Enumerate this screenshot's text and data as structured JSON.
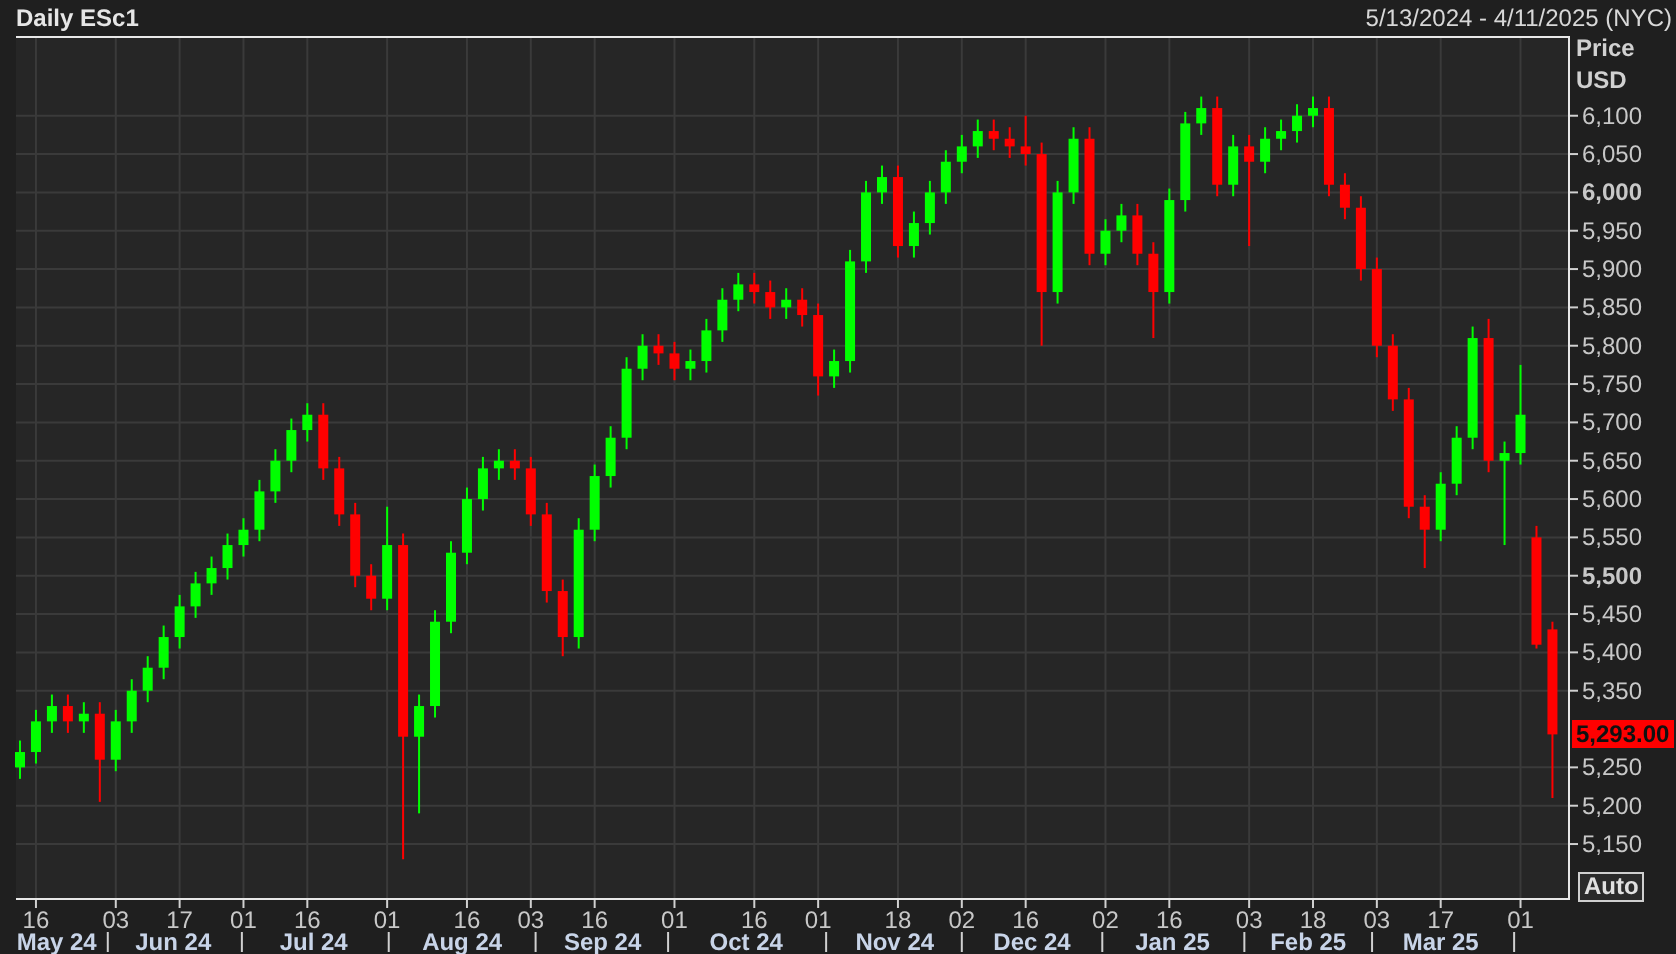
{
  "header": {
    "date_range": "5/13/2024 - 4/11/2025 (NYC)"
  },
  "chart": {
    "chart_data": {
      "type": "candlestick",
      "title": "Daily ESc1",
      "ylabel": "Price USD",
      "grid": true,
      "ylim": [
        5077,
        6204
      ],
      "categories": [
        null,
        "16",
        null,
        null,
        null,
        null,
        "03",
        null,
        null,
        null,
        "17",
        null,
        null,
        null,
        "01",
        null,
        null,
        null,
        "16",
        null,
        null,
        null,
        null,
        "01",
        null,
        null,
        null,
        null,
        "16",
        null,
        null,
        null,
        "03",
        null,
        null,
        null,
        "16",
        null,
        null,
        null,
        null,
        "01",
        null,
        null,
        null,
        null,
        "16",
        null,
        null,
        null,
        "01",
        null,
        null,
        null,
        null,
        "18",
        null,
        null,
        null,
        "02",
        null,
        null,
        null,
        "16",
        null,
        null,
        null,
        null,
        "02",
        null,
        null,
        null,
        "16",
        null,
        null,
        null,
        null,
        "03",
        null,
        null,
        null,
        "18",
        null,
        null,
        null,
        "03",
        null,
        null,
        null,
        "17",
        null,
        null,
        null,
        null,
        "01",
        null,
        null
      ],
      "ohlc": [
        [
          5250,
          5285,
          5235,
          5270
        ],
        [
          5270,
          5325,
          5255,
          5310
        ],
        [
          5310,
          5345,
          5295,
          5330
        ],
        [
          5330,
          5345,
          5295,
          5310
        ],
        [
          5310,
          5335,
          5295,
          5320
        ],
        [
          5320,
          5335,
          5205,
          5260
        ],
        [
          5260,
          5325,
          5245,
          5310
        ],
        [
          5310,
          5365,
          5295,
          5350
        ],
        [
          5350,
          5395,
          5335,
          5380
        ],
        [
          5380,
          5435,
          5365,
          5420
        ],
        [
          5420,
          5475,
          5405,
          5460
        ],
        [
          5460,
          5505,
          5445,
          5490
        ],
        [
          5490,
          5525,
          5475,
          5510
        ],
        [
          5510,
          5555,
          5495,
          5540
        ],
        [
          5540,
          5575,
          5525,
          5560
        ],
        [
          5560,
          5625,
          5545,
          5610
        ],
        [
          5610,
          5665,
          5595,
          5650
        ],
        [
          5650,
          5705,
          5635,
          5690
        ],
        [
          5690,
          5725,
          5675,
          5710
        ],
        [
          5710,
          5725,
          5625,
          5640
        ],
        [
          5640,
          5655,
          5565,
          5580
        ],
        [
          5580,
          5595,
          5485,
          5500
        ],
        [
          5500,
          5515,
          5455,
          5470
        ],
        [
          5470,
          5590,
          5455,
          5540
        ],
        [
          5540,
          5555,
          5130,
          5290
        ],
        [
          5290,
          5345,
          5190,
          5330
        ],
        [
          5330,
          5455,
          5315,
          5440
        ],
        [
          5440,
          5545,
          5425,
          5530
        ],
        [
          5530,
          5615,
          5515,
          5600
        ],
        [
          5600,
          5655,
          5585,
          5640
        ],
        [
          5640,
          5665,
          5625,
          5650
        ],
        [
          5650,
          5665,
          5625,
          5640
        ],
        [
          5640,
          5655,
          5565,
          5580
        ],
        [
          5580,
          5595,
          5465,
          5480
        ],
        [
          5480,
          5495,
          5395,
          5420
        ],
        [
          5420,
          5575,
          5405,
          5560
        ],
        [
          5560,
          5645,
          5545,
          5630
        ],
        [
          5630,
          5695,
          5615,
          5680
        ],
        [
          5680,
          5785,
          5665,
          5770
        ],
        [
          5770,
          5815,
          5755,
          5800
        ],
        [
          5800,
          5815,
          5775,
          5790
        ],
        [
          5790,
          5805,
          5755,
          5770
        ],
        [
          5770,
          5795,
          5755,
          5780
        ],
        [
          5780,
          5835,
          5765,
          5820
        ],
        [
          5820,
          5875,
          5805,
          5860
        ],
        [
          5860,
          5895,
          5845,
          5880
        ],
        [
          5880,
          5895,
          5855,
          5870
        ],
        [
          5870,
          5885,
          5835,
          5850
        ],
        [
          5850,
          5875,
          5835,
          5860
        ],
        [
          5860,
          5875,
          5825,
          5840
        ],
        [
          5840,
          5855,
          5735,
          5760
        ],
        [
          5760,
          5795,
          5745,
          5780
        ],
        [
          5780,
          5925,
          5765,
          5910
        ],
        [
          5910,
          6015,
          5895,
          6000
        ],
        [
          6000,
          6035,
          5985,
          6020
        ],
        [
          6020,
          6035,
          5915,
          5930
        ],
        [
          5930,
          5975,
          5915,
          5960
        ],
        [
          5960,
          6015,
          5945,
          6000
        ],
        [
          6000,
          6055,
          5985,
          6040
        ],
        [
          6040,
          6075,
          6025,
          6060
        ],
        [
          6060,
          6095,
          6045,
          6080
        ],
        [
          6080,
          6095,
          6055,
          6070
        ],
        [
          6070,
          6085,
          6045,
          6060
        ],
        [
          6060,
          6100,
          6035,
          6050
        ],
        [
          6050,
          6065,
          5800,
          5870
        ],
        [
          5870,
          6015,
          5855,
          6000
        ],
        [
          6000,
          6085,
          5985,
          6070
        ],
        [
          6070,
          6085,
          5905,
          5920
        ],
        [
          5920,
          5965,
          5905,
          5950
        ],
        [
          5950,
          5985,
          5935,
          5970
        ],
        [
          5970,
          5985,
          5905,
          5920
        ],
        [
          5920,
          5935,
          5810,
          5870
        ],
        [
          5870,
          6005,
          5855,
          5990
        ],
        [
          5990,
          6105,
          5975,
          6090
        ],
        [
          6090,
          6125,
          6075,
          6110
        ],
        [
          6110,
          6125,
          5995,
          6010
        ],
        [
          6010,
          6075,
          5995,
          6060
        ],
        [
          6060,
          6075,
          5930,
          6040
        ],
        [
          6040,
          6085,
          6025,
          6070
        ],
        [
          6070,
          6095,
          6055,
          6080
        ],
        [
          6080,
          6115,
          6065,
          6100
        ],
        [
          6100,
          6125,
          6085,
          6110
        ],
        [
          6110,
          6125,
          5995,
          6010
        ],
        [
          6010,
          6025,
          5965,
          5980
        ],
        [
          5980,
          5995,
          5885,
          5900
        ],
        [
          5900,
          5915,
          5785,
          5800
        ],
        [
          5800,
          5815,
          5715,
          5730
        ],
        [
          5730,
          5745,
          5575,
          5590
        ],
        [
          5590,
          5605,
          5510,
          5560
        ],
        [
          5560,
          5635,
          5545,
          5620
        ],
        [
          5620,
          5695,
          5605,
          5680
        ],
        [
          5680,
          5825,
          5665,
          5810
        ],
        [
          5810,
          5835,
          5635,
          5650
        ],
        [
          5650,
          5675,
          5540,
          5660
        ],
        [
          5660,
          5775,
          5645,
          5710
        ],
        [
          5550,
          5565,
          5405,
          5410
        ],
        [
          5430,
          5440,
          5210,
          5293
        ]
      ],
      "yticks": [
        {
          "value": 6100,
          "label": "6,100"
        },
        {
          "value": 6050,
          "label": "6,050"
        },
        {
          "value": 6000,
          "label": "6,000"
        },
        {
          "value": 5950,
          "label": "5,950"
        },
        {
          "value": 5900,
          "label": "5,900"
        },
        {
          "value": 5850,
          "label": "5,850"
        },
        {
          "value": 5800,
          "label": "5,800"
        },
        {
          "value": 5750,
          "label": "5,750"
        },
        {
          "value": 5700,
          "label": "5,700"
        },
        {
          "value": 5650,
          "label": "5,650"
        },
        {
          "value": 5600,
          "label": "5,600"
        },
        {
          "value": 5550,
          "label": "5,550"
        },
        {
          "value": 5500,
          "label": "5,500"
        },
        {
          "value": 5450,
          "label": "5,450"
        },
        {
          "value": 5400,
          "label": "5,400"
        },
        {
          "value": 5350,
          "label": "5,350"
        },
        {
          "value": 5250,
          "label": "5,250"
        },
        {
          "value": 5200,
          "label": "5,200"
        },
        {
          "value": 5150,
          "label": "5,150"
        }
      ]
    },
    "months": [
      "May 24",
      "Jun 24",
      "Jul 24",
      "Aug 24",
      "Sep 24",
      "Oct 24",
      "Nov 24",
      "Dec 24",
      "Jan 25",
      "Feb 25",
      "Mar 25"
    ],
    "last_price": "5,293.00",
    "scale_button": "Auto"
  }
}
